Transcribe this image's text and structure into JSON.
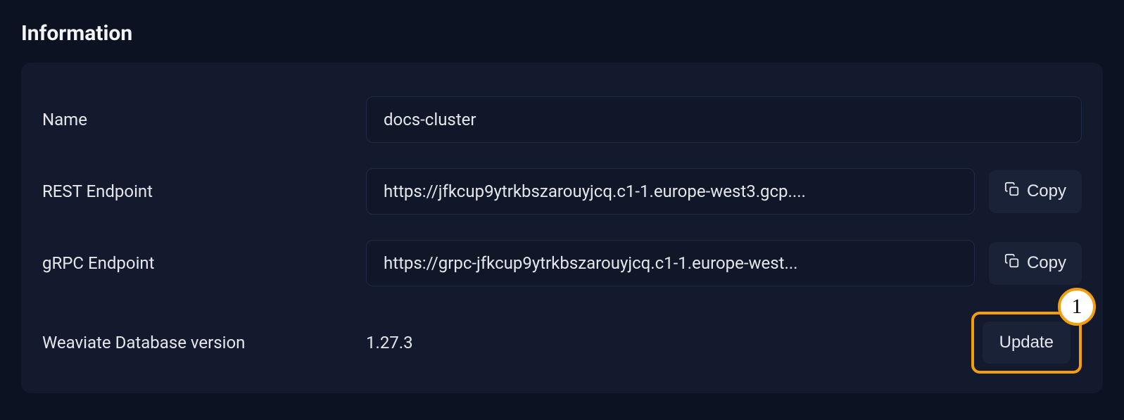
{
  "section": {
    "title": "Information"
  },
  "fields": {
    "name": {
      "label": "Name",
      "value": "docs-cluster"
    },
    "rest": {
      "label": "REST Endpoint",
      "value": "https://jfkcup9ytrkbszarouyjcq.c1-1.europe-west3.gcp....",
      "copy_label": "Copy"
    },
    "grpc": {
      "label": "gRPC Endpoint",
      "value": "https://grpc-jfkcup9ytrkbszarouyjcq.c1-1.europe-west...",
      "copy_label": "Copy"
    },
    "version": {
      "label": "Weaviate Database version",
      "value": "1.27.3",
      "update_label": "Update"
    }
  },
  "annotation": {
    "badge": "1"
  }
}
